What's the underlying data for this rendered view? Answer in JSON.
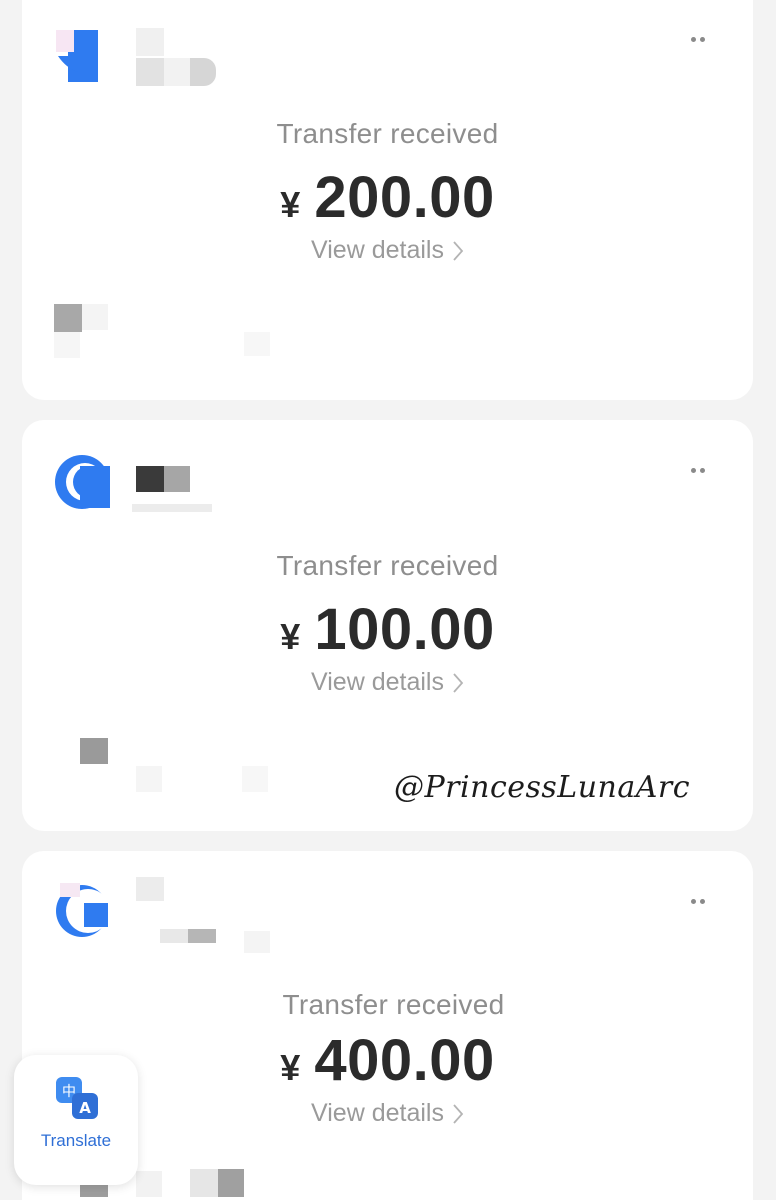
{
  "transfers": [
    {
      "label": "Transfer received",
      "currency": "¥",
      "amount": "200.00",
      "details_label": "View details"
    },
    {
      "label": "Transfer received",
      "currency": "¥",
      "amount": "100.00",
      "details_label": "View details"
    },
    {
      "label": "Transfer received",
      "currency": "¥",
      "amount": "400.00",
      "details_label": "View details"
    }
  ],
  "watermark": "@PrincessLunaArc",
  "translate_widget": {
    "label": "Translate",
    "icon": "translate-icon"
  },
  "icons": {
    "more": "more-dots-icon",
    "chevron": "chevron-right-icon",
    "avatar": "app-logo-icon"
  },
  "colors": {
    "card": "#ffffff",
    "background": "#f3f3f3",
    "amount": "#2b2b2b",
    "label": "#8e8e8e",
    "accent": "#2f7bf0"
  }
}
